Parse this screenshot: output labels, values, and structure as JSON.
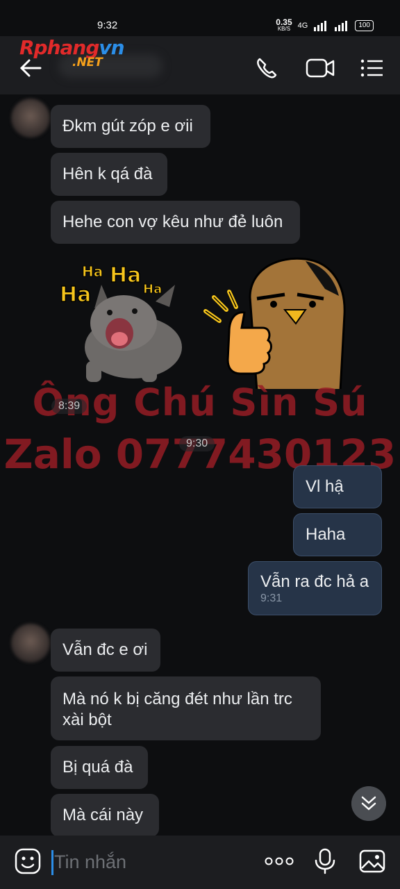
{
  "status": {
    "time": "9:32",
    "speed": "0.35",
    "speed_unit": "KB/S",
    "net": "4G",
    "battery": "100"
  },
  "logo": {
    "part1": "Rphang",
    "part2": "vn",
    "net": ".NET"
  },
  "messages": [
    {
      "text": "Đkm gút zóp e ơii"
    },
    {
      "text": "Hên k qá đà"
    },
    {
      "text": "Hehe con vợ kêu như đẻ luôn"
    },
    {
      "text": "Vl hậ"
    },
    {
      "text": "Haha"
    },
    {
      "text": "Vẫn ra đc hả a",
      "time": "9:31"
    },
    {
      "text": "Vẫn đc e ơi"
    },
    {
      "text": "Mà nó k bị căng đét như lần trc xài bột"
    },
    {
      "text": "Bị quá đà"
    },
    {
      "text": "Mà cái này"
    }
  ],
  "sticker": {
    "ha_words": [
      "Ha",
      "Ha",
      "Ha",
      "Ha"
    ]
  },
  "timestamps": {
    "sticker_time": "8:39",
    "divider_time": "9:30"
  },
  "watermark": {
    "line1": "Ông Chú Sìn Sú",
    "line2": "Zalo 0777430123"
  },
  "input": {
    "placeholder": "Tin nhắn"
  },
  "colors": {
    "accent": "#2b8ee8",
    "outgoing_bubble": "#263448",
    "incoming_bubble": "#2b2c30"
  },
  "icons": [
    "back-arrow-icon",
    "phone-icon",
    "video-call-icon",
    "menu-icon",
    "emoji-icon",
    "more-icon",
    "mic-icon",
    "image-icon",
    "chevron-double-down-icon"
  ]
}
